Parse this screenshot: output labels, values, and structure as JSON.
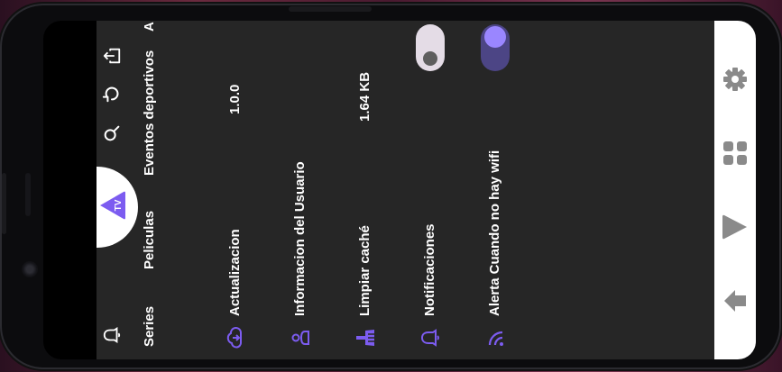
{
  "tabs": [
    {
      "label": "Series"
    },
    {
      "label": "Peliculas"
    },
    {
      "label": "Eventos deportivos"
    },
    {
      "label": "A"
    }
  ],
  "logo": {
    "text": "TV"
  },
  "settings": {
    "rows": [
      {
        "label": "Actualizacion",
        "value": "1.0.0",
        "icon": "cloud-icon"
      },
      {
        "label": "Informacion del Usuario",
        "value": "",
        "icon": "user-icon"
      },
      {
        "label": "Limpiar caché",
        "value": "1.64 KB",
        "icon": "broom-icon"
      },
      {
        "label": "Notificaciones",
        "value": "",
        "icon": "bell-icon",
        "toggle": false
      },
      {
        "label": "Alerta Cuando no hay wifi",
        "value": "",
        "icon": "wifi-icon",
        "toggle": true
      }
    ]
  },
  "navbar": {
    "items": [
      "gear-icon",
      "grid-icon",
      "tv-icon",
      "home-icon"
    ]
  },
  "colors": {
    "accent": "#7c5cf0",
    "background": "#262626",
    "toggle_on_track": "#4c4585",
    "toggle_off_track": "#e4dce6"
  }
}
